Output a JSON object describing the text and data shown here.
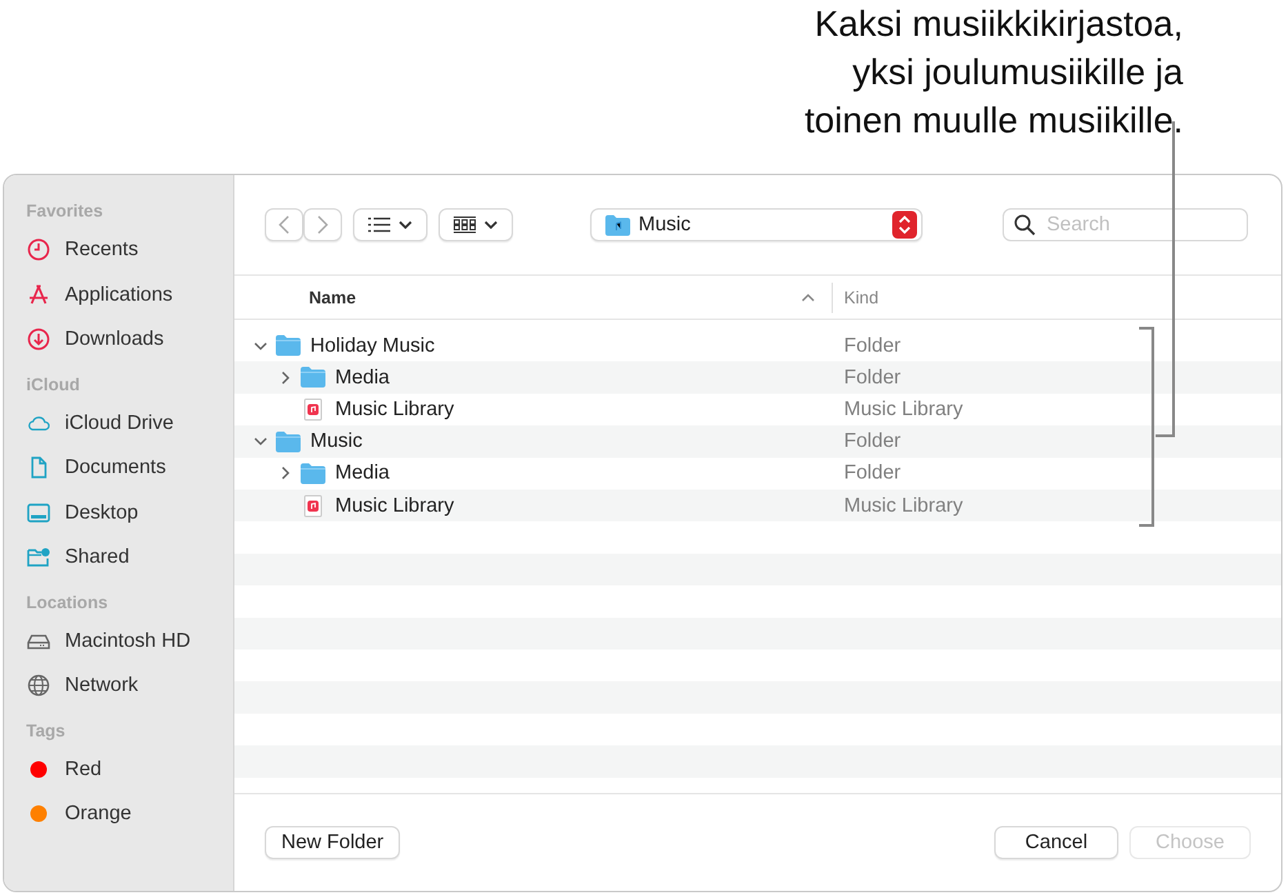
{
  "callout": {
    "lines": [
      "Kaksi musiikkikirjastoa,",
      "yksi joulumusiikille ja",
      "toinen muulle musiikille."
    ]
  },
  "sidebar": {
    "sections": [
      {
        "title": "Favorites",
        "items": [
          {
            "label": "Recents"
          },
          {
            "label": "Applications"
          },
          {
            "label": "Downloads"
          }
        ]
      },
      {
        "title": "iCloud",
        "items": [
          {
            "label": "iCloud Drive"
          },
          {
            "label": "Documents"
          },
          {
            "label": "Desktop"
          },
          {
            "label": "Shared"
          }
        ]
      },
      {
        "title": "Locations",
        "items": [
          {
            "label": "Macintosh HD"
          },
          {
            "label": "Network"
          }
        ]
      },
      {
        "title": "Tags",
        "items": [
          {
            "label": "Red",
            "color": "#fe0000"
          },
          {
            "label": "Orange",
            "color": "#fe8000"
          }
        ]
      }
    ]
  },
  "toolbar": {
    "location": "Music",
    "search": {
      "placeholder": "Search"
    }
  },
  "table": {
    "columns": [
      {
        "label": "Name",
        "sorted": true
      },
      {
        "label": "Kind",
        "sorted": false
      }
    ],
    "rows": [
      {
        "name": "Holiday Music",
        "kind": "folder",
        "type": "Folder",
        "expanded": true,
        "children": [
          {
            "name": "Media",
            "kind": "folder",
            "type": "Folder",
            "expanded": false
          },
          {
            "name": "Music Library",
            "kind": "library",
            "type": "Music Library"
          }
        ]
      },
      {
        "name": "Music",
        "kind": "folder",
        "type": "Folder",
        "expanded": true,
        "children": [
          {
            "name": "Media",
            "kind": "folder",
            "type": "Folder",
            "expanded": false
          },
          {
            "name": "Music Library",
            "kind": "library",
            "type": "Music Library"
          }
        ]
      }
    ]
  },
  "buttons": [
    {
      "label": "New Folder",
      "disabled": false
    },
    {
      "label": "Cancel",
      "disabled": false
    },
    {
      "label": "Choose",
      "disabled": true
    }
  ]
}
